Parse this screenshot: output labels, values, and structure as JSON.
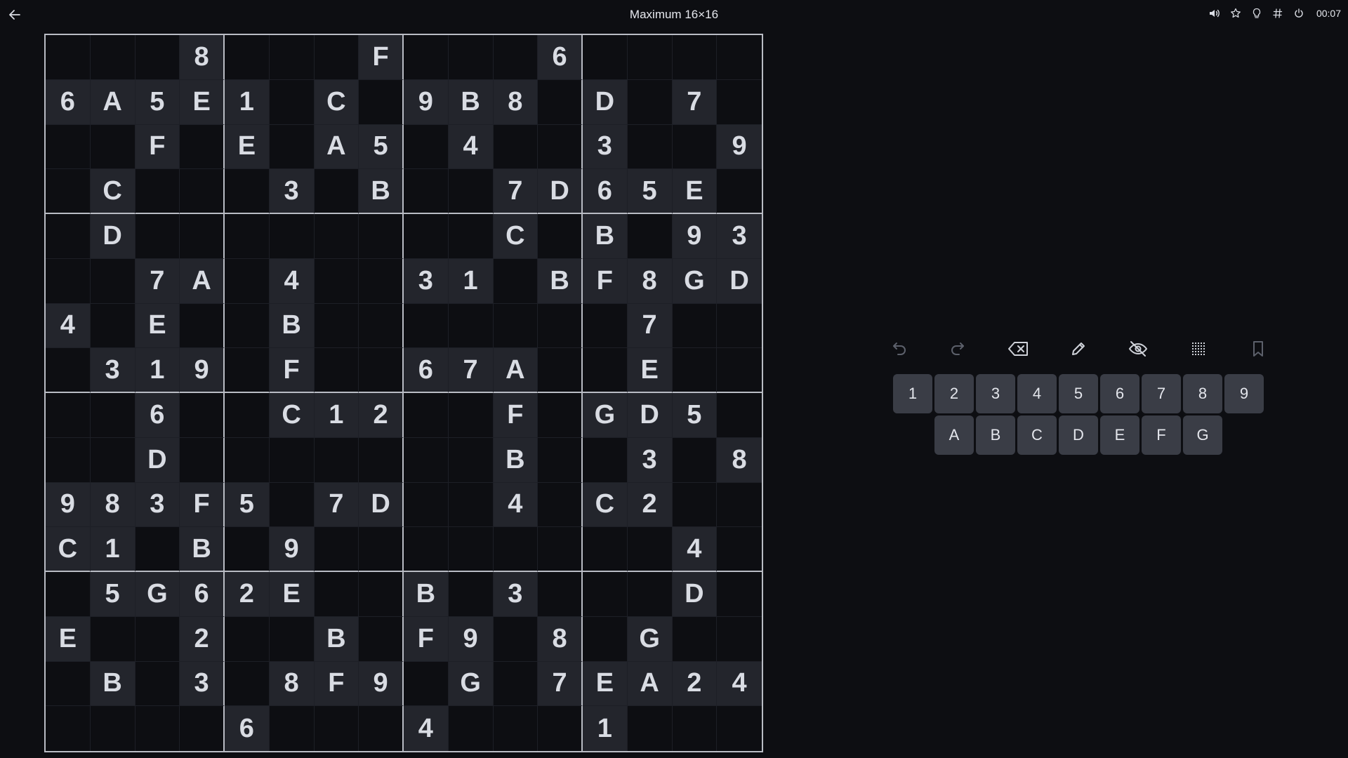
{
  "header": {
    "title": "Maximum 16×16",
    "timer": "00:07"
  },
  "board": {
    "rows": [
      [
        "",
        "",
        "",
        "8",
        "",
        "",
        "",
        "F",
        "",
        "",
        "",
        "6",
        "",
        "",
        "",
        ""
      ],
      [
        "6",
        "A",
        "5",
        "E",
        "1",
        "",
        "C",
        "",
        "9",
        "B",
        "8",
        "",
        "D",
        "",
        "7",
        ""
      ],
      [
        "",
        "",
        "F",
        "",
        "E",
        "",
        "A",
        "5",
        "",
        "4",
        "",
        "",
        "3",
        "",
        "",
        "9"
      ],
      [
        "",
        "C",
        "",
        "",
        "",
        "3",
        "",
        "B",
        "",
        "",
        "7",
        "D",
        "6",
        "5",
        "E",
        ""
      ],
      [
        "",
        "D",
        "",
        "",
        "",
        "",
        "",
        "",
        "",
        "",
        "C",
        "",
        "B",
        "",
        "9",
        "3"
      ],
      [
        "",
        "",
        "7",
        "A",
        "",
        "4",
        "",
        "",
        "3",
        "1",
        "",
        "B",
        "F",
        "8",
        "G",
        "D"
      ],
      [
        "4",
        "",
        "E",
        "",
        "",
        "B",
        "",
        "",
        "",
        "",
        "",
        "",
        "",
        "7",
        "",
        ""
      ],
      [
        "",
        "3",
        "1",
        "9",
        "",
        "F",
        "",
        "",
        "6",
        "7",
        "A",
        "",
        "",
        "E",
        "",
        ""
      ],
      [
        "",
        "",
        "6",
        "",
        "",
        "C",
        "1",
        "2",
        "",
        "",
        "F",
        "",
        "G",
        "D",
        "5",
        ""
      ],
      [
        "",
        "",
        "D",
        "",
        "",
        "",
        "",
        "",
        "",
        "",
        "B",
        "",
        "",
        "3",
        "",
        "8"
      ],
      [
        "9",
        "8",
        "3",
        "F",
        "5",
        "",
        "7",
        "D",
        "",
        "",
        "4",
        "",
        "C",
        "2",
        "",
        ""
      ],
      [
        "C",
        "1",
        "",
        "B",
        "",
        "9",
        "",
        "",
        "",
        "",
        "",
        "",
        "",
        "",
        "4",
        ""
      ],
      [
        "",
        "5",
        "G",
        "6",
        "2",
        "E",
        "",
        "",
        "B",
        "",
        "3",
        "",
        "",
        "",
        "D",
        ""
      ],
      [
        "E",
        "",
        "",
        "2",
        "",
        "",
        "B",
        "",
        "F",
        "9",
        "",
        "8",
        "",
        "G",
        "",
        ""
      ],
      [
        "",
        "B",
        "",
        "3",
        "",
        "8",
        "F",
        "9",
        "",
        "G",
        "",
        "7",
        "E",
        "A",
        "2",
        "4"
      ],
      [
        "",
        "",
        "",
        "",
        "6",
        "",
        "",
        "",
        "4",
        "",
        "",
        "",
        "1",
        "",
        "",
        ""
      ]
    ]
  },
  "toolbar": {
    "tools": [
      {
        "name": "undo-icon"
      },
      {
        "name": "redo-icon"
      },
      {
        "name": "erase-icon"
      },
      {
        "name": "pencil-icon"
      },
      {
        "name": "hide-icon"
      },
      {
        "name": "grid-icon"
      },
      {
        "name": "bookmark-icon"
      }
    ]
  },
  "keypad": {
    "row1": [
      "1",
      "2",
      "3",
      "4",
      "5",
      "6",
      "7",
      "8",
      "9"
    ],
    "row2": [
      "A",
      "B",
      "C",
      "D",
      "E",
      "F",
      "G"
    ]
  },
  "icons": {
    "top_right": [
      "volume-icon",
      "star-icon",
      "bulb-icon",
      "hash-icon",
      "power-icon"
    ]
  },
  "colors": {
    "background": "#0d0e12",
    "given_cell": "#23252c",
    "key_bg": "#3a3d46",
    "box_border": "#b9bcc4"
  }
}
